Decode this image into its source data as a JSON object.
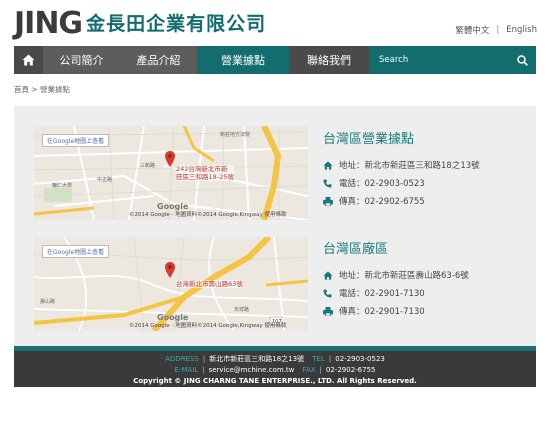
{
  "header": {
    "logo_jing": "JING",
    "logo_cn": "金長田企業有限公司",
    "lang_zh": "繁體中文",
    "lang_en": "English"
  },
  "nav": {
    "about": "公司簡介",
    "products": "產品介紹",
    "sites": "營業據點",
    "contact": "聯絡我們",
    "search_placeholder": "Search"
  },
  "breadcrumb": "首頁 > 營業據點",
  "locations": [
    {
      "title": "台灣區營業據點",
      "address": "地址：新北市新莊區三和路18之13號",
      "phone": "電話：02-2903-0523",
      "fax": "傳真：02-2902-6755",
      "map_link": "在Google地圖上查看",
      "map_pin_label": "242台灣新北市新\n莊區三和路18-25號",
      "map_footer": "©2014 Google - 地圖資料©2014 Google,Kingway   使用條款",
      "google": "Google"
    },
    {
      "title": "台灣區廠區",
      "address": "地址：新北市新莊區壽山路63-6號",
      "phone": "電話：02-2901-7130",
      "fax": "傳真：02-2901-7130",
      "map_link": "在Google地圖上查看",
      "map_pin_label": "台灣新北市壽山路63號",
      "map_footer": "©2014 Google - 地圖資料©2014 Google,Kingway   使用條款",
      "google": "Google"
    }
  ],
  "footer": {
    "address_key": "ADDRESS",
    "address_val": "新北市新莊區三和路18之13號",
    "tel_key": "TEL",
    "tel_val": "02-2903-0523",
    "email_key": "E-MAIL",
    "email_val": "service@mchine.com.tw",
    "fax_key": "FAX",
    "fax_val": "02-2902-6755",
    "copyright": "Copyright © JING CHARNG TANE ENTERPRISE., LTD. All Rights Reserved."
  },
  "colors": {
    "brand_teal": "#136d6f",
    "nav_gray": "#5d5d5d",
    "footer_dark": "#3a3a3a",
    "pin_red": "#d63a2e",
    "road_yellow": "#f6c445"
  }
}
